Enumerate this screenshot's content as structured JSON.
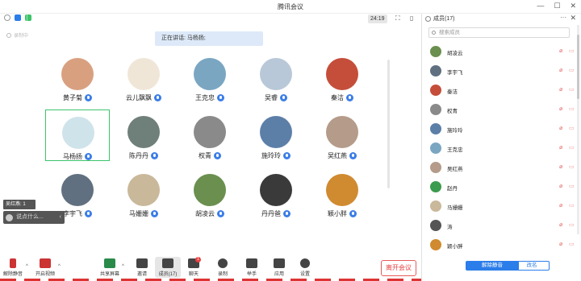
{
  "window": {
    "title": "腾讯会议",
    "min": "—",
    "max": "☐",
    "close": "✕"
  },
  "meeting": {
    "timer": "24:19",
    "recording_label": "录制中",
    "speaking": "正在讲话: 马杨扬;"
  },
  "grid": [
    {
      "name": "黄子菊",
      "color": "#d9a080"
    },
    {
      "name": "云儿飘飘",
      "color": "#f0e6d8"
    },
    {
      "name": "王克忠",
      "color": "#7aa6c2"
    },
    {
      "name": "吴睿",
      "color": "#b8c8d8"
    },
    {
      "name": "秦洁",
      "color": "#c44e3a"
    },
    {
      "name": "马杨扬",
      "color": "#cfe3ea"
    },
    {
      "name": "陈丹丹",
      "color": "#6f7f7a"
    },
    {
      "name": "权青",
      "color": "#8a8a8a"
    },
    {
      "name": "施玲玲",
      "color": "#5c7fa8"
    },
    {
      "name": "吴红燕",
      "color": "#b49b8a"
    },
    {
      "name": "李宇飞",
      "color": "#607080"
    },
    {
      "name": "马姗姗",
      "color": "#c9b89a"
    },
    {
      "name": "胡凌云",
      "color": "#6a8f4e"
    },
    {
      "name": "丹丹爸",
      "color": "#3a3a3a"
    },
    {
      "name": "颖小胖",
      "color": "#d08a30"
    }
  ],
  "chat": {
    "count_label": "吴红燕: 1",
    "placeholder": "说点什么...",
    "arrow": "‹"
  },
  "toolbar": {
    "unmute": "解除静音",
    "video": "开启视频",
    "share": "共享屏幕",
    "invite": "邀请",
    "members": "成员(17)",
    "chat": "聊天",
    "chat_badge": "1",
    "record": "录制",
    "raise": "举手",
    "apps": "应用",
    "settings": "设置",
    "leave": "离开会议"
  },
  "panel": {
    "title": "成员(17)",
    "search_placeholder": "搜索成员",
    "members": [
      {
        "name": "胡凌云",
        "color": "#6a8f4e"
      },
      {
        "name": "李宇飞",
        "color": "#607080"
      },
      {
        "name": "秦洁",
        "color": "#c44e3a"
      },
      {
        "name": "权青",
        "color": "#8a8a8a"
      },
      {
        "name": "施玲玲",
        "color": "#5c7fa8"
      },
      {
        "name": "王克忠",
        "color": "#7aa6c2"
      },
      {
        "name": "吴红燕",
        "color": "#b49b8a"
      },
      {
        "name": "赵丹",
        "color": "#3b9b4e"
      },
      {
        "name": "马姗姗",
        "color": "#c9b89a"
      },
      {
        "name": "涛",
        "color": "#555555"
      },
      {
        "name": "颖小胖",
        "color": "#d08a30"
      }
    ],
    "mute_all": "解除静音",
    "rename": "改名"
  }
}
